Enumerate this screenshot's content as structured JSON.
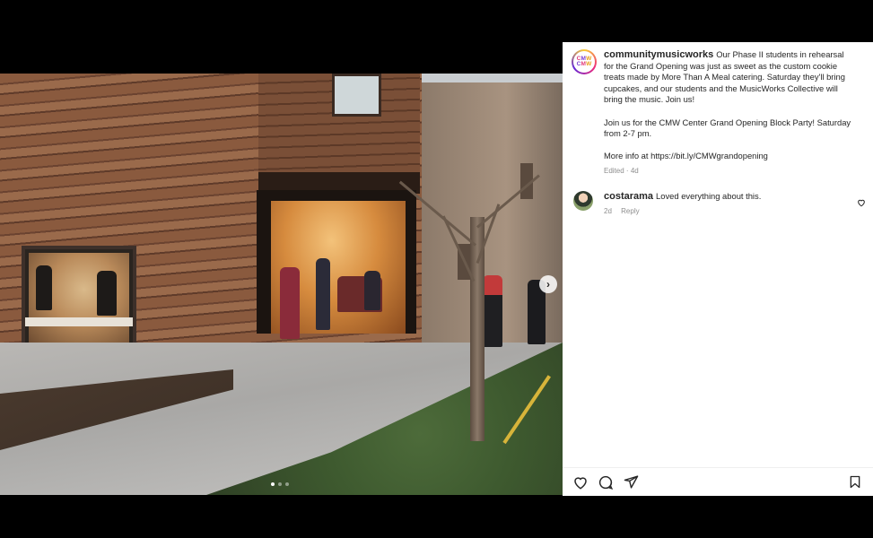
{
  "post": {
    "username": "communitymusicworks",
    "avatar_logo": {
      "line1": "CMW",
      "line2": "CMW"
    },
    "caption_p1": "Our Phase II students in rehearsal for the Grand Opening was just as sweet as the custom cookie treats made by More Than A Meal catering. Saturday they'll bring cupcakes, and our students and the MusicWorks Collective will bring the music. Join us!",
    "caption_p2": "Join us for the CMW Center Grand Opening Block Party! Saturday from 2-7 pm.",
    "caption_p3": "More info at https://bit.ly/CMWgrandopening",
    "edited_label": "Edited",
    "edited_sep": "·",
    "edited_time": "4d"
  },
  "comments": [
    {
      "username": "costarama",
      "text": "Loved everything about this.",
      "time": "2d",
      "reply_label": "Reply"
    }
  ],
  "carousel": {
    "next_glyph": "›",
    "dot_count": 3,
    "active_index": 0
  },
  "icons": {
    "like": "heart-icon",
    "comment": "comment-icon",
    "share": "paper-plane-icon",
    "save": "bookmark-icon",
    "comment_like": "heart-icon"
  },
  "colors": {
    "text": "#262626",
    "muted": "#8e8e8e",
    "brand_pink": "#e23b7a",
    "brand_purple": "#7b3fd0",
    "brand_orange": "#e8a11e"
  }
}
